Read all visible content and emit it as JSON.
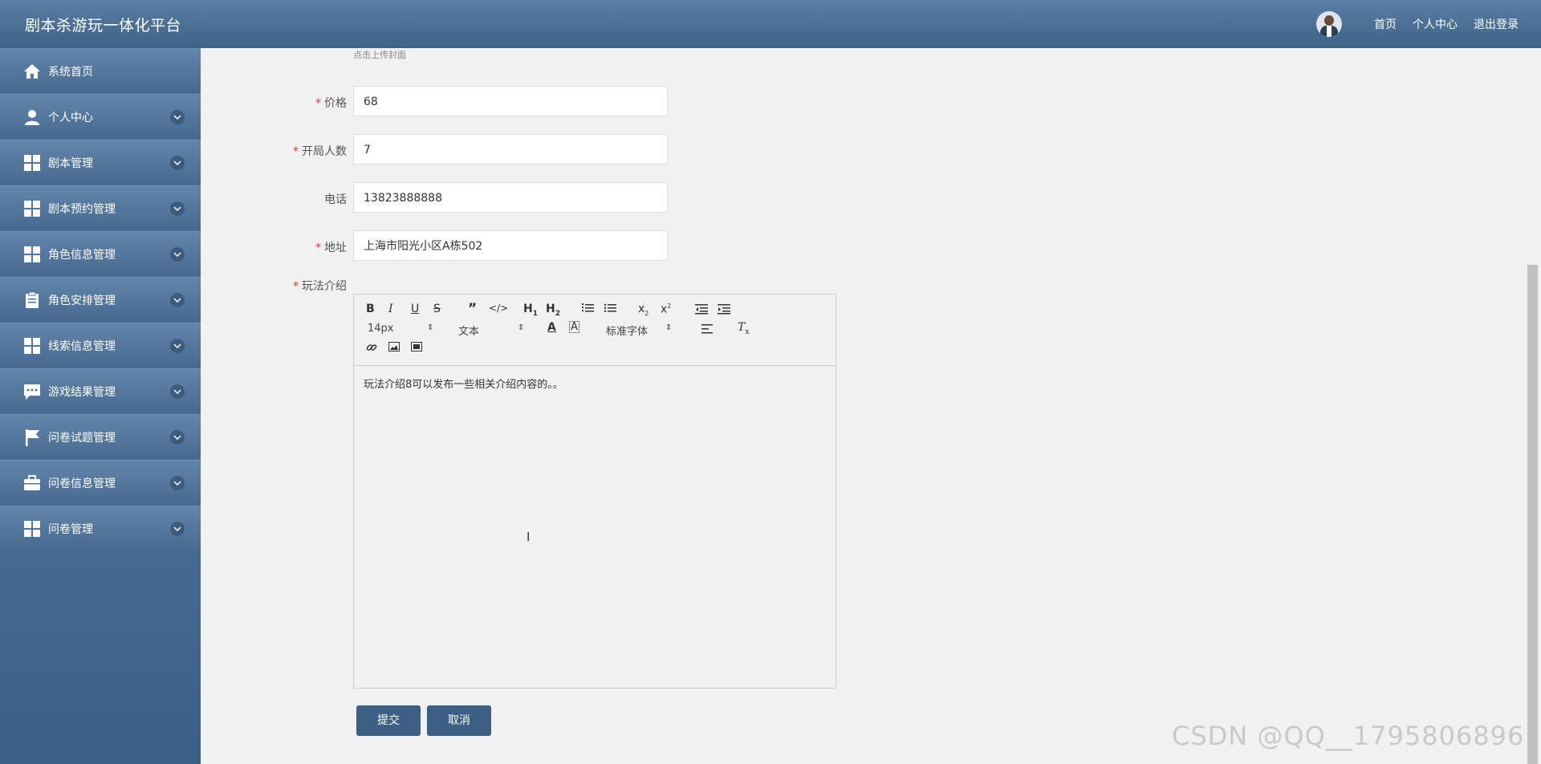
{
  "app": {
    "title": "剧本杀游玩一体化平台"
  },
  "topnav": {
    "home": "首页",
    "profile": "个人中心",
    "logout": "退出登录"
  },
  "sidebar": {
    "items": [
      {
        "label": "系统首页",
        "icon": "home-icon",
        "has_arrow": false
      },
      {
        "label": "个人中心",
        "icon": "user-icon",
        "has_arrow": true
      },
      {
        "label": "剧本管理",
        "icon": "grid-icon",
        "has_arrow": true
      },
      {
        "label": "剧本预约管理",
        "icon": "grid-icon",
        "has_arrow": true
      },
      {
        "label": "角色信息管理",
        "icon": "grid-icon",
        "has_arrow": true
      },
      {
        "label": "角色安排管理",
        "icon": "clipboard-icon",
        "has_arrow": true
      },
      {
        "label": "线索信息管理",
        "icon": "grid-icon",
        "has_arrow": true
      },
      {
        "label": "游戏结果管理",
        "icon": "chat-icon",
        "has_arrow": true
      },
      {
        "label": "问卷试题管理",
        "icon": "flag-icon",
        "has_arrow": true
      },
      {
        "label": "问卷信息管理",
        "icon": "briefcase-icon",
        "has_arrow": true
      },
      {
        "label": "问卷管理",
        "icon": "grid-icon",
        "has_arrow": true
      }
    ]
  },
  "form": {
    "upload_hint": "点击上传封面",
    "price": {
      "label": "价格",
      "required": true,
      "value": "68"
    },
    "players": {
      "label": "开局人数",
      "required": true,
      "value": "7"
    },
    "phone": {
      "label": "电话",
      "required": false,
      "value": "13823888888"
    },
    "address": {
      "label": "地址",
      "required": true,
      "value": "上海市阳光小区A栋502"
    },
    "intro": {
      "label": "玩法介绍",
      "required": true,
      "value": "玩法介绍8可以发布一些相关介绍内容的。。"
    },
    "required_mark": "*"
  },
  "editor": {
    "font_size": "14px",
    "header_select": "文本",
    "font_family": "标准字体"
  },
  "buttons": {
    "submit": "提交",
    "cancel": "取消"
  },
  "watermark": "CSDN @QQ__1795806896",
  "colors": {
    "primary": "#3d5f86",
    "required": "#e4393c"
  }
}
